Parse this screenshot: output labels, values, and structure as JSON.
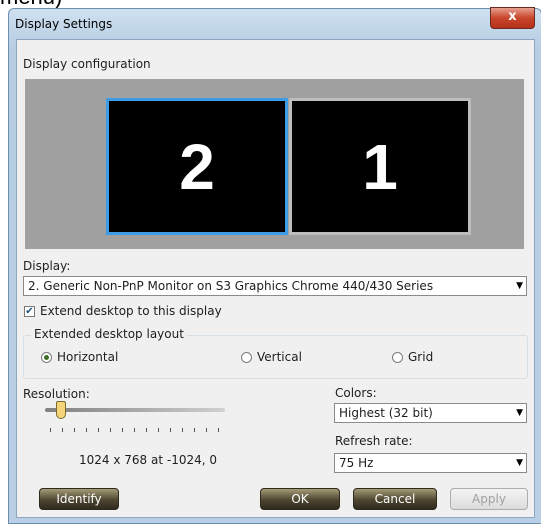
{
  "fragment_text": "menu)",
  "window": {
    "title": "Display Settings",
    "close_glyph": "x"
  },
  "config_label": "Display configuration",
  "monitors": [
    {
      "number": "2",
      "selected": true
    },
    {
      "number": "1",
      "selected": false
    }
  ],
  "display": {
    "label": "Display:",
    "value": "2. Generic Non-PnP Monitor on S3 Graphics Chrome 440/430 Series"
  },
  "extend": {
    "label": "Extend desktop to this display",
    "checked": true
  },
  "layout": {
    "title": "Extended desktop layout",
    "options": [
      "Horizontal",
      "Vertical",
      "Grid"
    ],
    "selected": "Horizontal"
  },
  "resolution": {
    "label": "Resolution:",
    "value_text": "1024 x 768 at -1024, 0"
  },
  "colors": {
    "label": "Colors:",
    "value": "Highest (32 bit)"
  },
  "refresh": {
    "label": "Refresh rate:",
    "value": "75 Hz"
  },
  "buttons": {
    "identify": "Identify",
    "ok": "OK",
    "cancel": "Cancel",
    "apply": "Apply"
  },
  "colors_theme": {
    "selected_border": "#3c9ce8",
    "monitor_bg": "#000000"
  }
}
